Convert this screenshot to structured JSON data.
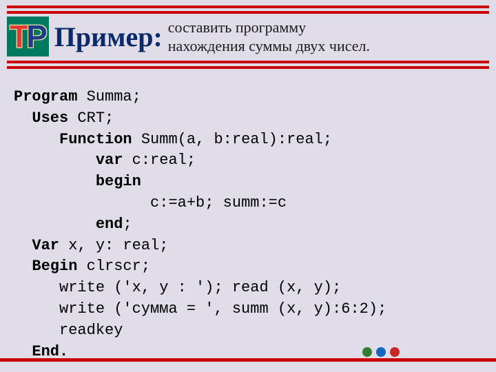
{
  "header": {
    "logo_t": "T",
    "logo_p": "P",
    "title": "Пример:",
    "subtitle_line1": "составить программу",
    "subtitle_line2": "нахождения суммы двух чисел."
  },
  "code": {
    "l1_kw": "Program",
    "l1_rest": " Summa;",
    "l2_kw": "Uses",
    "l2_rest": " CRT;",
    "l3_kw": "Function",
    "l3_rest": " Summ(a, b:real):real;",
    "l4_kw": "var",
    "l4_rest": " c:real;",
    "l5_kw": "begin",
    "l6_rest": "c:=a+b; summ:=c",
    "l7_kw": "end",
    "l7_rest": ";",
    "l8_kw": "Var",
    "l8_rest": " x, y: real;",
    "l9_kw": "Begin",
    "l9_rest": " clrscr;",
    "l10_rest": "write ('x, y : '); read (x, y);",
    "l11_rest": "write ('сумма = ', summ (x, y):6:2);",
    "l12_rest": "readkey",
    "l13_kw": "End."
  }
}
